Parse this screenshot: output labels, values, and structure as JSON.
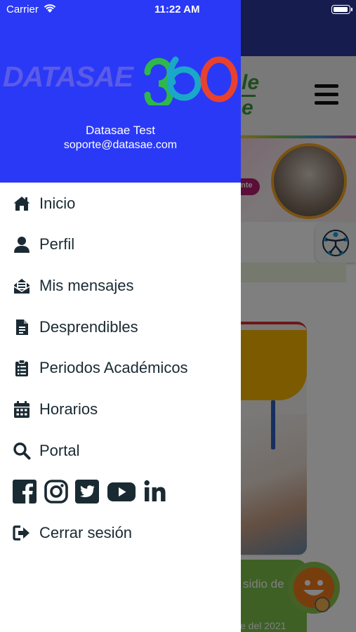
{
  "status_bar": {
    "carrier": "Carrier",
    "time": "11:22 AM"
  },
  "drawer": {
    "header_color": "#2a39f5",
    "brand": {
      "text": "DATASAE",
      "number": "360",
      "number_colors": [
        "#2fb84a",
        "#1aa8c8",
        "#e8412e"
      ]
    },
    "user": {
      "name": "Datasae Test",
      "email": "soporte@datasae.com"
    },
    "menu": [
      {
        "label": "Inicio",
        "icon": "home-icon"
      },
      {
        "label": "Perfil",
        "icon": "user-icon"
      },
      {
        "label": "Mis mensajes",
        "icon": "inbox-icon"
      },
      {
        "label": "Desprendibles",
        "icon": "document-icon"
      },
      {
        "label": "Periodos Académicos",
        "icon": "clipboard-icon"
      },
      {
        "label": "Horarios",
        "icon": "calendar-icon"
      },
      {
        "label": "Portal",
        "icon": "search-icon"
      }
    ],
    "social": [
      "facebook-icon",
      "instagram-icon",
      "twitter-icon",
      "youtube-icon",
      "linkedin-icon"
    ],
    "logout": {
      "label": "Cerrar sesión",
      "icon": "sign-out-icon"
    }
  },
  "background": {
    "logo_text": "le\ne",
    "banner_pill": "nte",
    "card_text_1": "sidio de",
    "card_text_2": "e del 2021"
  }
}
